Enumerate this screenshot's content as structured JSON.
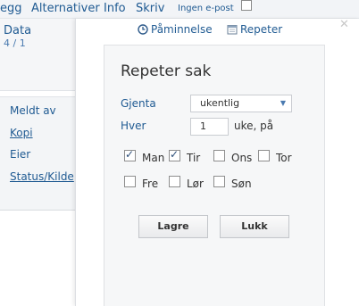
{
  "menu": {
    "items": [
      "egg",
      "Alternativer",
      "Info",
      "Skriv"
    ],
    "small_item": "Ingen e-post"
  },
  "left": {
    "data_title": "Data",
    "data_sub": "4 / 1",
    "links": [
      "Meldt av",
      "Kopi",
      "Eier",
      "Status/Kilde"
    ]
  },
  "popup": {
    "tab_reminder": "Påminnelse",
    "tab_repeat": "Repeter",
    "heading": "Repeter sak",
    "repeat_label": "Gjenta",
    "repeat_value": "ukentlig",
    "every_label": "Hver",
    "every_value": "1",
    "unit_label": "uke, på",
    "days": [
      {
        "label": "Man",
        "checked": true
      },
      {
        "label": "Tir",
        "checked": true
      },
      {
        "label": "Ons",
        "checked": false
      },
      {
        "label": "Tor",
        "checked": false
      },
      {
        "label": "Fre",
        "checked": false
      },
      {
        "label": "Lør",
        "checked": false
      },
      {
        "label": "Søn",
        "checked": false
      }
    ],
    "save_label": "Lagre",
    "close_label": "Lukk"
  }
}
